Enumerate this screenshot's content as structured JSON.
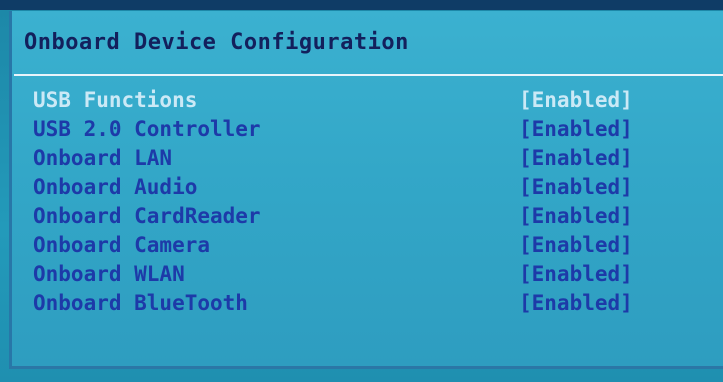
{
  "panel": {
    "title": "Onboard Device Configuration",
    "items": [
      {
        "label": "USB Functions",
        "value": "[Enabled]",
        "selected": true
      },
      {
        "label": "USB 2.0 Controller",
        "value": "[Enabled]"
      },
      {
        "label": "Onboard LAN",
        "value": "[Enabled]"
      },
      {
        "label": "Onboard Audio",
        "value": "[Enabled]"
      },
      {
        "label": "Onboard CardReader",
        "value": "[Enabled]"
      },
      {
        "label": "Onboard Camera",
        "value": "[Enabled]"
      },
      {
        "label": "Onboard WLAN",
        "value": "[Enabled]"
      },
      {
        "label": "Onboard BlueTooth",
        "value": "[Enabled]"
      }
    ]
  },
  "colors": {
    "background": "#2fa3c5",
    "title_text": "#13205c",
    "item_text": "#1d3aa8",
    "selected_text": "#cbe9f6",
    "divider": "#e8f4fb"
  }
}
